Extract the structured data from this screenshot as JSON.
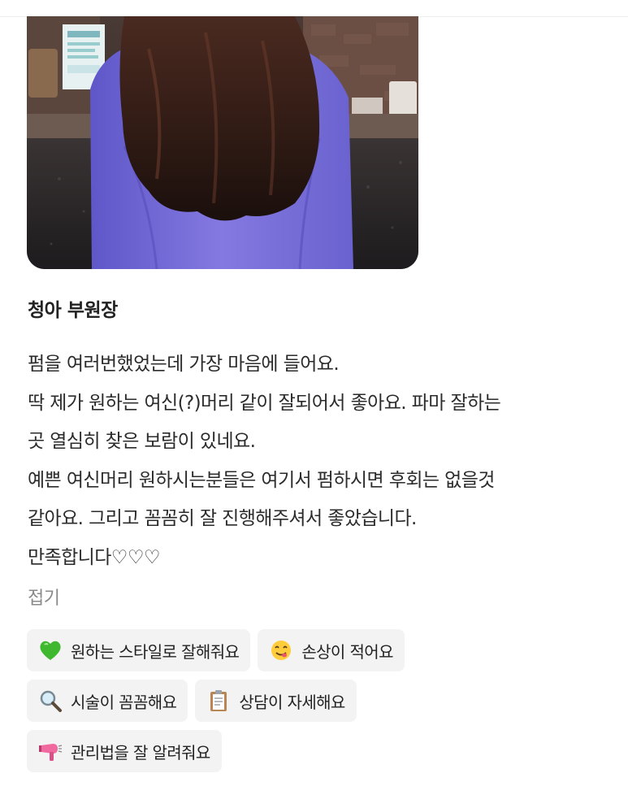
{
  "review": {
    "reviewer_name": "청아 부원장",
    "lines": [
      "펌을 여러번했었는데 가장 마음에 들어요.",
      "딱 제가 원하는 여신(?)머리 같이 잘되어서 좋아요. 파마 잘하는",
      "곳 열심히 찾은 보람이 있네요.",
      "예쁜 여신머리 원하시는분들은 여기서 펌하시면 후회는 없을것",
      "같아요. 그리고 꼼꼼히 잘 진행해주셔서 좋았습니다.",
      "만족합니다♡♡♡"
    ],
    "collapse_label": "접기"
  },
  "tags": [
    {
      "label": "원하는 스타일로 잘해줘요",
      "icon": "green-heart-icon"
    },
    {
      "label": "손상이 적어요",
      "icon": "savoring-face-icon"
    },
    {
      "label": "시술이 꼼꼼해요",
      "icon": "magnifying-glass-icon"
    },
    {
      "label": "상담이 자세해요",
      "icon": "clipboard-icon"
    },
    {
      "label": "관리법을 잘 알려줘요",
      "icon": "hair-dryer-icon"
    }
  ],
  "colors": {
    "tag_background": "#f3f3f3",
    "collapse_text": "#8a8a8a"
  }
}
